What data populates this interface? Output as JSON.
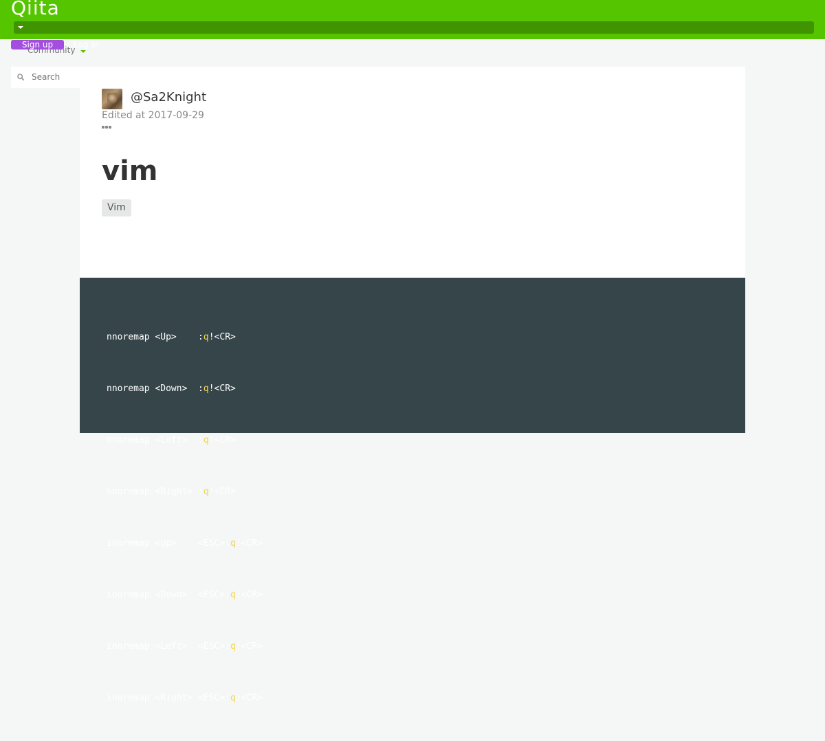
{
  "header": {
    "logo": "Qiita",
    "community_label": "Community",
    "signup_label": "Sign up",
    "login_label": "Log in",
    "colors": {
      "brand": "#55c500",
      "signup": "#a34ee0"
    }
  },
  "search": {
    "placeholder": "Search"
  },
  "article": {
    "author": "@Sa2Knight",
    "edited": "Edited at 2017-09-29",
    "title": "vim",
    "tags": [
      "Vim"
    ]
  },
  "code": {
    "lines": [
      {
        "pre": "nnoremap <Up>    :",
        "hl": "q",
        "post": "!<CR>"
      },
      {
        "pre": "nnoremap <Down>  :",
        "hl": "q",
        "post": "!<CR>"
      },
      {
        "pre": "nnoremap <Left>  :",
        "hl": "q",
        "post": "!<CR>"
      },
      {
        "pre": "nnoremap <Right> :",
        "hl": "q",
        "post": "!<CR>"
      },
      {
        "pre": "inoremap <Up>    <ESC>:",
        "hl": "q",
        "post": "!<CR>"
      },
      {
        "pre": "inoremap <Down>  <ESC>:",
        "hl": "q",
        "post": "!<CR>"
      },
      {
        "pre": "inoremap <Left>  <ESC>:",
        "hl": "q",
        "post": "!<CR>"
      },
      {
        "pre": "inoremap <Right> <ESC>:",
        "hl": "q",
        "post": "!<CR>"
      }
    ],
    "colors": {
      "background": "#364549",
      "keyword": "#f4d84f"
    }
  }
}
